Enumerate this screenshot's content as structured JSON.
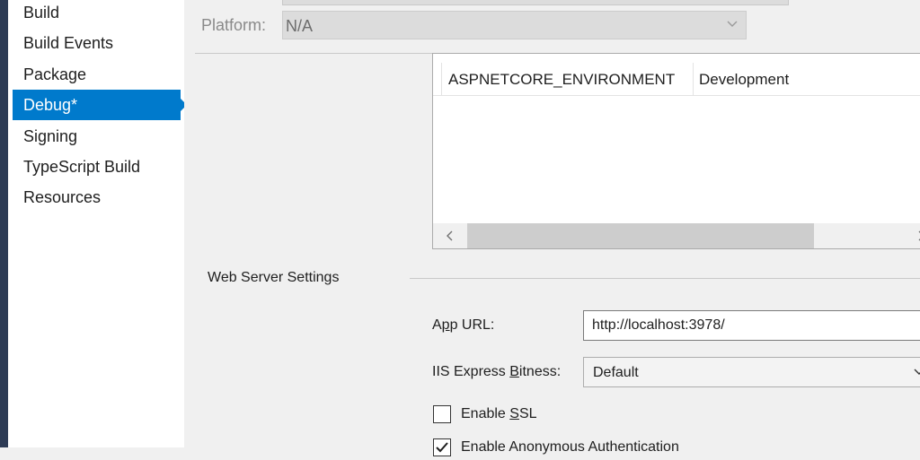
{
  "sidebar": {
    "items": [
      {
        "label": "Build",
        "selected": false
      },
      {
        "label": "Build Events",
        "selected": false
      },
      {
        "label": "Package",
        "selected": false
      },
      {
        "label": "Debug*",
        "selected": true
      },
      {
        "label": "Signing",
        "selected": false
      },
      {
        "label": "TypeScript Build",
        "selected": false
      },
      {
        "label": "Resources",
        "selected": false
      }
    ]
  },
  "platform": {
    "label": "Platform:",
    "value": "N/A",
    "disabled": true
  },
  "env_vars": {
    "rows": [
      {
        "name": "ASPNETCORE_ENVIRONMENT",
        "value": "Development"
      }
    ]
  },
  "web_server": {
    "section_title": "Web Server Settings",
    "app_url": {
      "label_pre": "A",
      "label_access": "p",
      "label_post": "p URL:",
      "value": "http://localhost:3978/"
    },
    "bitness": {
      "label_pre": "IIS Express ",
      "label_access": "B",
      "label_post": "itness:",
      "value": "Default"
    },
    "enable_ssl": {
      "label_pre": "Enable ",
      "label_access": "S",
      "label_post": "SL",
      "checked": false
    },
    "anonymous_auth": {
      "label": "Enable Anonymous Authentication",
      "checked": true
    }
  },
  "colors": {
    "selected_bg": "#007acc",
    "sidebar_bg": "#ffffff",
    "main_bg": "#f0f0f0"
  },
  "icons": {
    "dropdown": "chevron-down-icon",
    "scroll_left": "chevron-left-icon",
    "scroll_right": "chevron-right-icon",
    "check": "checkmark-icon"
  }
}
